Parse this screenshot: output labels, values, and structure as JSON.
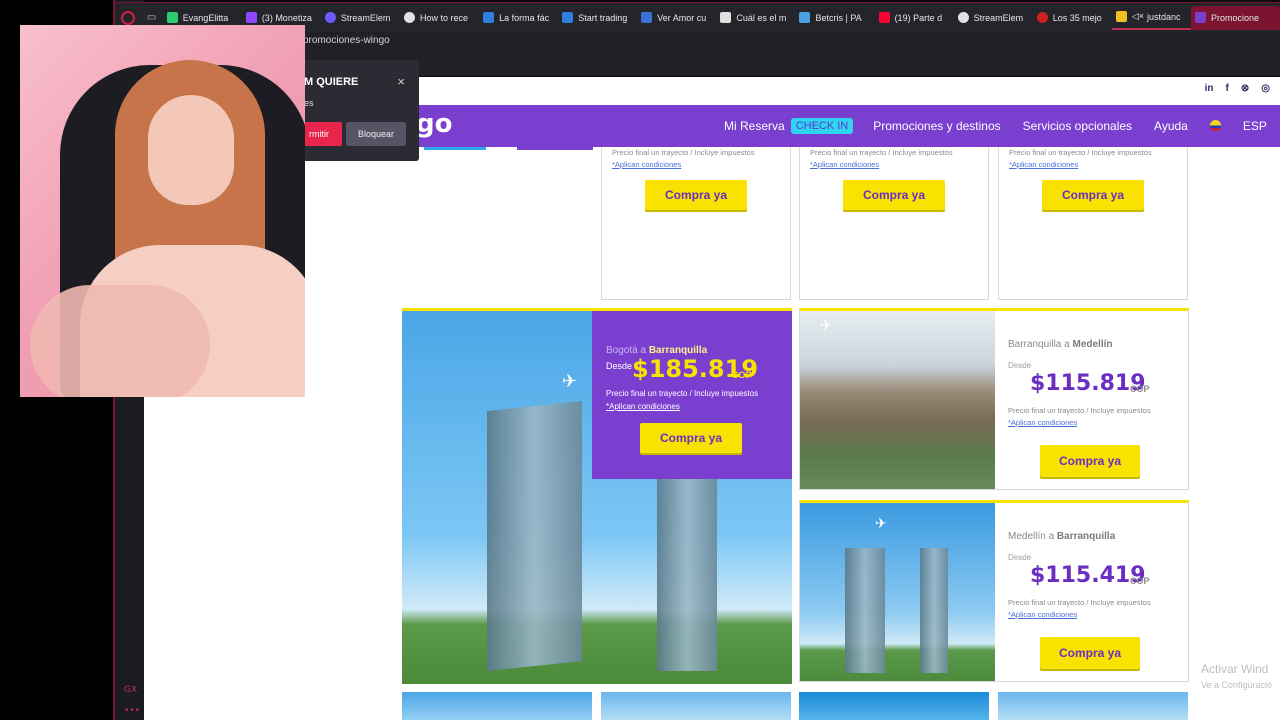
{
  "browser": {
    "tabs": [
      {
        "label": "EvangElitta",
        "color": "#2ecc71"
      },
      {
        "label": "(3) Monetiza",
        "color": "#9146ff"
      },
      {
        "label": "StreamElem",
        "color": "#6a5cff"
      },
      {
        "label": "How to rece",
        "color": "#e0e0e0"
      },
      {
        "label": "La forma fác",
        "color": "#2f7fe0"
      },
      {
        "label": "Start trading",
        "color": "#2f7fe0"
      },
      {
        "label": "Ver Amor cu",
        "color": "#3a6fd8"
      },
      {
        "label": "Cuál es el m",
        "color": "#e0e0e0"
      },
      {
        "label": "Betcris | PA",
        "color": "#4aa0e0"
      },
      {
        "label": "(19) Parte d",
        "color": "#ff0033"
      },
      {
        "label": "StreamElem",
        "color": "#e0e0e0"
      },
      {
        "label": "Los 35 mejo",
        "color": "#d02020"
      },
      {
        "label": "justdanc",
        "color": "#f0c020"
      },
      {
        "label": "Promocione",
        "color": "#7b3fd0"
      }
    ],
    "url": "promociones-wingo"
  },
  "permission_popup": {
    "title": "M QUIERE",
    "subtitle": "es",
    "allow_label": "rmitir",
    "block_label": "Bloquear",
    "close_symbol": "×"
  },
  "site": {
    "logo": "go",
    "social": [
      "in",
      "f",
      "⊗",
      "◎"
    ],
    "nav": {
      "mi_reserva": "Mi Reserva",
      "check_in": "CHECK IN",
      "promociones": "Promociones y destinos",
      "servicios": "Servicios opcionales",
      "ayuda": "Ayuda",
      "lang": "ESP"
    },
    "common": {
      "note": "Precio final un trayecto / Incluye impuestos",
      "conditions": "*Aplican condiciones",
      "buy": "Compra ya",
      "desde": "Desde",
      "currency": "COP"
    },
    "featured": {
      "route_from": "Bogotá a ",
      "route_to": "Barranquilla",
      "price": "$185.819"
    },
    "side_cards": [
      {
        "route_from": "Barranquilla a ",
        "route_to": "Medellín",
        "price": "$115.819"
      },
      {
        "route_from": "Medellín a ",
        "route_to": "Barranquilla",
        "price": "$115.419"
      }
    ]
  },
  "sidebar_text": [
    "GX",
    "•••"
  ],
  "watermark": {
    "line1": "Activar Wind",
    "line2": "Ve a Configuració"
  },
  "colors": {
    "brand_purple": "#7b3fd0",
    "brand_yellow": "#f8e200",
    "opera_red": "#d02040"
  }
}
